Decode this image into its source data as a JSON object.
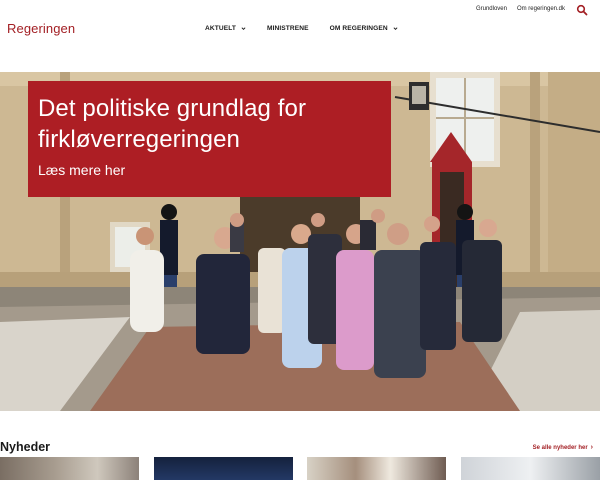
{
  "header": {
    "logo": "Regeringen",
    "util_links": [
      "Grundloven",
      "Om regeringen.dk"
    ],
    "search_icon": "search-icon",
    "nav": [
      {
        "label": "AKTUELT",
        "has_dropdown": true
      },
      {
        "label": "MINISTRENE",
        "has_dropdown": false
      },
      {
        "label": "OM REGERINGEN",
        "has_dropdown": true
      }
    ]
  },
  "hero": {
    "title": "Det politiske grundlag for firkløverregeringen",
    "link_label": "Læs mere her"
  },
  "news": {
    "heading": "Nyheder",
    "see_all": "Se alle nyheder her"
  },
  "colors": {
    "brand": "#a31f24",
    "hero_card": "#ad1e24"
  }
}
